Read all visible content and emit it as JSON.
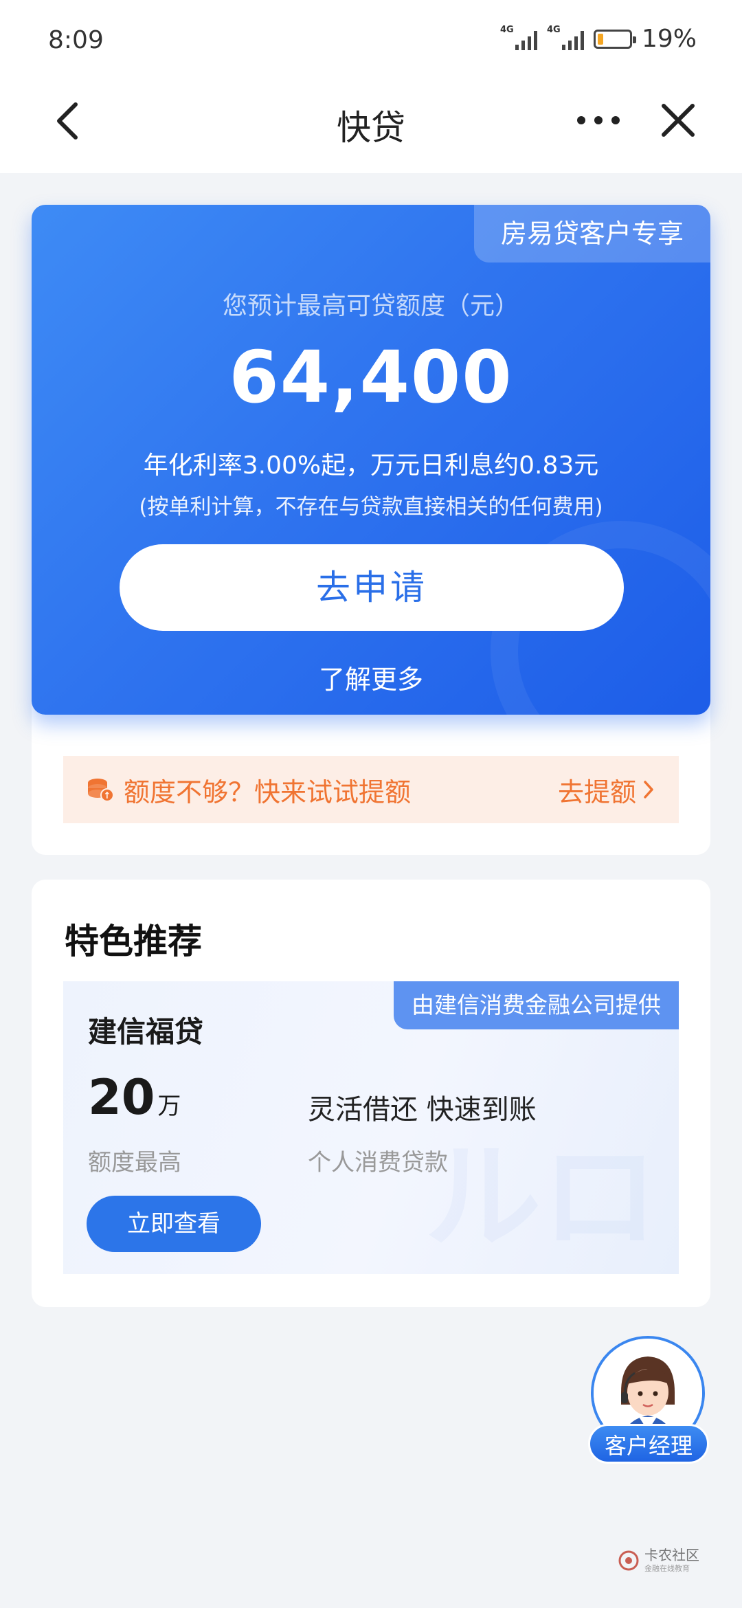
{
  "status_bar": {
    "time": "8:09",
    "network_1": "4G",
    "network_2": "4G",
    "battery_percent": "19%",
    "battery_level": 0.19
  },
  "nav": {
    "title": "快贷",
    "back_icon": "chevron-left-icon",
    "more_icon": "more-horizontal-icon",
    "close_icon": "close-icon"
  },
  "hero": {
    "badge": "房易贷客户专享",
    "subtitle": "您预计最高可贷额度（元）",
    "amount": "64,400",
    "rate_text": "年化利率3.00%起，万元日利息约0.83元",
    "note": "(按单利计算，不存在与贷款直接相关的任何费用)",
    "apply_label": "去申请",
    "learn_more": "了解更多",
    "colors": {
      "start": "#3e8bf5",
      "end": "#1d5de8"
    }
  },
  "boost": {
    "icon": "coin-stack-icon",
    "text": "额度不够？快来试试提额",
    "action": "去提额",
    "color": "#f07432"
  },
  "recommend": {
    "title": "特色推荐",
    "product": {
      "provider_tag": "由建信消费金融公司提供",
      "name": "建信福贷",
      "amount_number": "20",
      "amount_unit": "万",
      "amount_label": "额度最高",
      "feature": "灵活借还 快速到账",
      "feature_label": "个人消费贷款",
      "view_label": "立即查看"
    }
  },
  "manager": {
    "label": "客户经理"
  },
  "watermark": {
    "title": "卡农社区",
    "subtitle": "金融在线教育"
  },
  "colors": {
    "accent": "#2c75e9",
    "background": "#f2f4f7"
  }
}
